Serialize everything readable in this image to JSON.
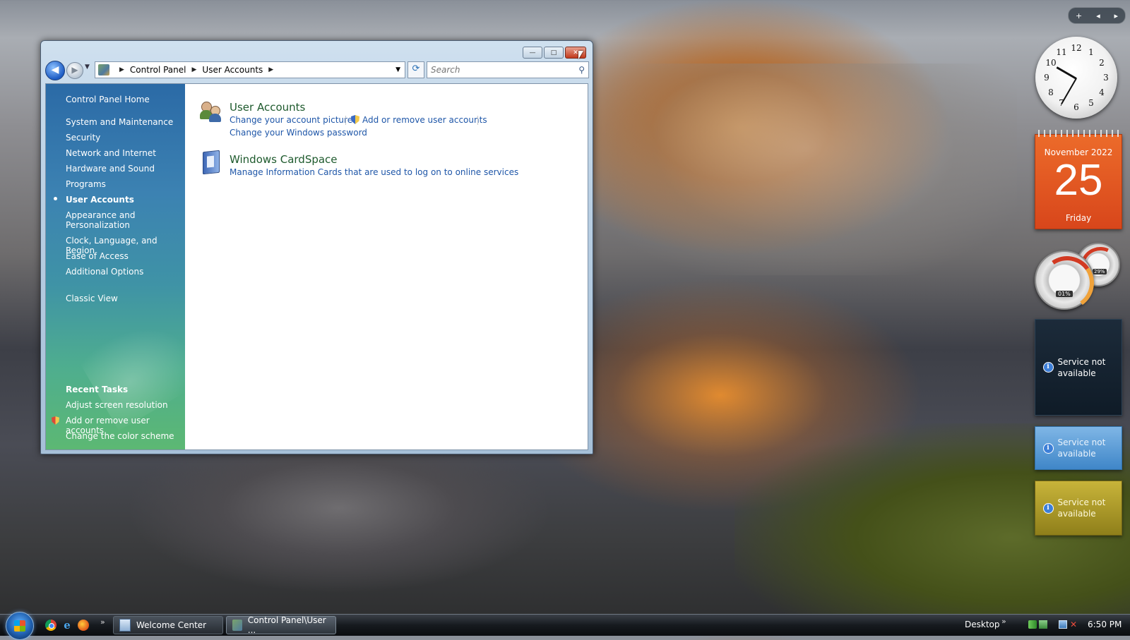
{
  "window": {
    "address": [
      "Control Panel",
      "User Accounts"
    ],
    "search_placeholder": "Search",
    "min_label": "—",
    "max_label": "□",
    "close_label": "✕"
  },
  "sidebar": {
    "home": "Control Panel Home",
    "categories": [
      "System and Maintenance",
      "Security",
      "Network and Internet",
      "Hardware and Sound",
      "Programs",
      "User Accounts",
      "Appearance and Personalization",
      "Clock, Language, and Region",
      "Ease of Access",
      "Additional Options"
    ],
    "current": "User Accounts",
    "classic_view": "Classic View",
    "recent_tasks_heading": "Recent Tasks",
    "recent_tasks": [
      "Adjust screen resolution",
      "Add or remove user accounts",
      "Change the color scheme"
    ]
  },
  "main": {
    "user_accounts": {
      "title": "User Accounts",
      "tasks": [
        "Change your account picture",
        "Add or remove user accounts",
        "Change your Windows password"
      ]
    },
    "cardspace": {
      "title": "Windows CardSpace",
      "tasks": [
        "Manage Information Cards that are used to log on to online services"
      ]
    }
  },
  "gadgets": {
    "controls": [
      "+",
      "◂",
      "▸"
    ],
    "clock_numbers": [
      "12",
      "1",
      "2",
      "3",
      "4",
      "5",
      "6",
      "7",
      "8",
      "9",
      "10",
      "11"
    ],
    "calendar": {
      "month": "November 2022",
      "day": "25",
      "weekday": "Friday"
    },
    "meters": {
      "cpu": "01%",
      "memory": "29%"
    },
    "service_messages": [
      "Service not available",
      "Service not available",
      "Service not available"
    ]
  },
  "taskbar": {
    "quick_launch_more": "»",
    "items": [
      "Welcome Center",
      "Control Panel\\User ..."
    ],
    "desktop": "Desktop",
    "desktop_more": "»",
    "time": "6:50 PM"
  },
  "colors": {
    "link": "#1e56a8",
    "category_title": "#1e5a2d",
    "calendar": "#e35a22"
  }
}
